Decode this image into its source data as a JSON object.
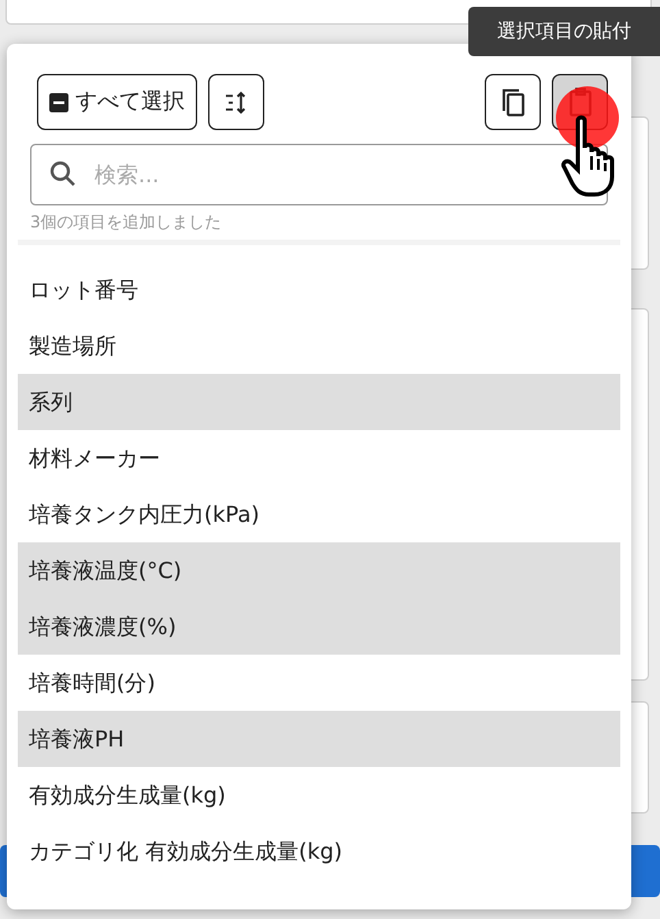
{
  "tooltip": {
    "text": "選択項目の貼付"
  },
  "toolbar": {
    "select_all": {
      "label": "すべて選択",
      "indeterminate": true
    },
    "sort": {
      "pressed": false
    },
    "copy": {
      "pressed": false
    },
    "paste": {
      "pressed": true
    }
  },
  "search": {
    "placeholder": "検索..."
  },
  "status": "3個の項目を追加しました",
  "items": [
    {
      "label": "ロット番号",
      "selected": false
    },
    {
      "label": "製造場所",
      "selected": false
    },
    {
      "label": "系列",
      "selected": true
    },
    {
      "label": "材料メーカー",
      "selected": false
    },
    {
      "label": "培養タンク内圧力(kPa)",
      "selected": false
    },
    {
      "label": "培養液温度(°C)",
      "selected": true
    },
    {
      "label": "培養液濃度(%)",
      "selected": true
    },
    {
      "label": "培養時間(分)",
      "selected": false
    },
    {
      "label": "培養液PH",
      "selected": true
    },
    {
      "label": "有効成分生成量(kg)",
      "selected": false
    },
    {
      "label": "カテゴリ化 有効成分生成量(kg)",
      "selected": false
    }
  ]
}
